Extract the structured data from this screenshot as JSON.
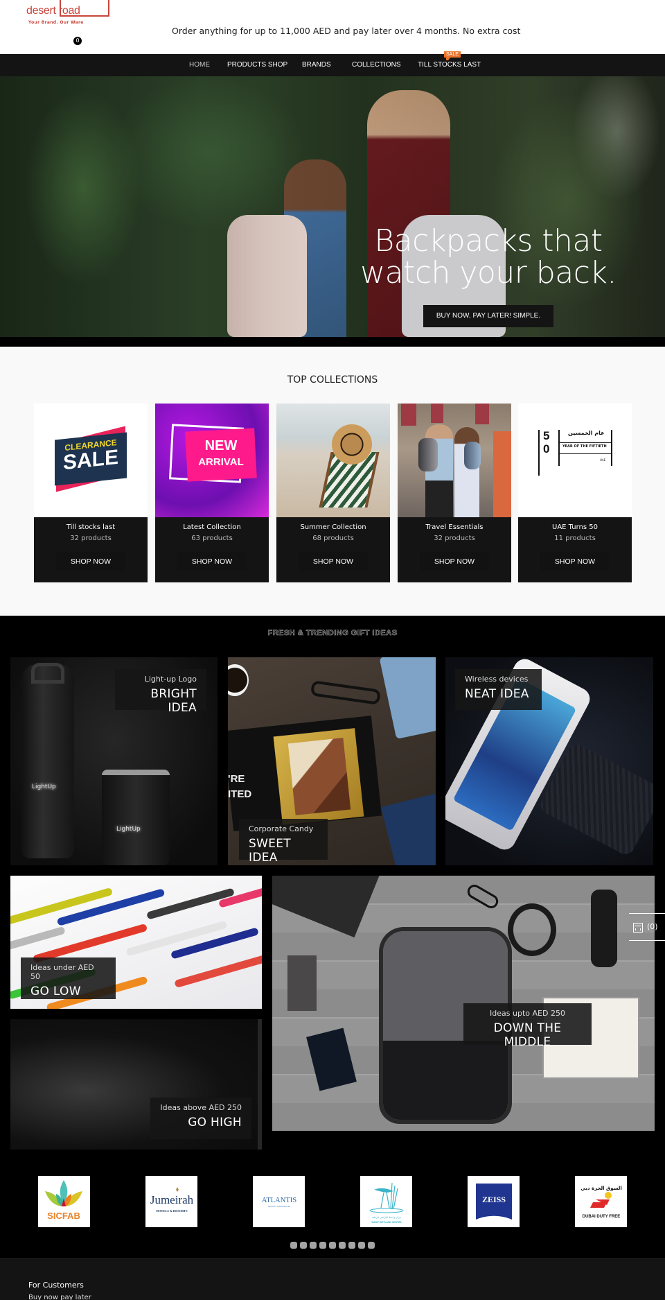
{
  "header": {
    "logo_word": "desert road",
    "logo_tagline": "Your Brand. Our Ware",
    "cart_count": "0",
    "announcement": "Order anything for up to 11,000 AED and pay later over 4 months. No extra cost"
  },
  "nav": {
    "items": [
      {
        "label": "HOME"
      },
      {
        "label": "PRODUCTS SHOP"
      },
      {
        "label": "BRANDS"
      },
      {
        "label": "COLLECTIONS"
      },
      {
        "label": "TILL STOCKS LAST"
      }
    ],
    "sale_badge": "SALE",
    "accent": "#e8732a"
  },
  "hero": {
    "title_line1": "Backpacks that",
    "title_line2": "watch your back.",
    "cta": "BUY NOW. PAY LATER! SIMPLE."
  },
  "top_collections": {
    "title": "TOP COLLECTIONS",
    "cards": [
      {
        "name": "Till stocks last",
        "count": "32 products",
        "cta": "SHOP NOW",
        "image_text": [
          "CLEARANCE",
          "SALE"
        ]
      },
      {
        "name": "Latest Collection",
        "count": "63 products",
        "cta": "SHOP NOW",
        "image_text": [
          "NEW",
          "ARRIVAL"
        ]
      },
      {
        "name": "Summer Collection",
        "count": "68 products",
        "cta": "SHOP NOW"
      },
      {
        "name": "Travel Essentials",
        "count": "32 products",
        "cta": "SHOP NOW"
      },
      {
        "name": "UAE Turns 50",
        "count": "11 products",
        "cta": "SHOP NOW",
        "image_text": [
          "5",
          "0",
          "عام الخمسين",
          "YEAR OF THE FIFTIETH",
          "UAE"
        ]
      }
    ]
  },
  "trending": {
    "title": "FRESH & TRENDING GIFT IDEAS",
    "tiles": [
      {
        "sub": "Light-up Logo",
        "title": "BRIGHT IDEA",
        "image_text": "LightUp"
      },
      {
        "sub": "Corporate Candy",
        "title": "SWEET IDEA",
        "image_text": "'RE\nITED"
      },
      {
        "sub": "Wireless devices",
        "title": "NEAT IDEA"
      },
      {
        "sub": "Ideas under AED 50",
        "title": "GO LOW"
      },
      {
        "sub": "Ideas above AED 250",
        "title": "GO HIGH"
      },
      {
        "sub": "Ideas upto AED 250",
        "title": "DOWN THE MIDDLE"
      }
    ]
  },
  "side_cart": {
    "count": "(0)"
  },
  "brands": {
    "logos": [
      {
        "name": "SICFAB"
      },
      {
        "name": "Jumeirah",
        "sub": "HOTELS & RESORTS"
      },
      {
        "name": "ATLANTIS",
        "sub": "RESORTS & RESIDENCES"
      },
      {
        "name": "WASIT WETLAND CENTRE",
        "sub": "مركز واسط للأراضي الرطبة"
      },
      {
        "name": "ZEISS"
      },
      {
        "name": "DUBAI DUTY FREE",
        "sub": "السوق الحرة دبي"
      }
    ],
    "carousel_pages": 9
  },
  "footer": {
    "heading": "For Customers",
    "links": [
      "Buy now pay later"
    ]
  }
}
